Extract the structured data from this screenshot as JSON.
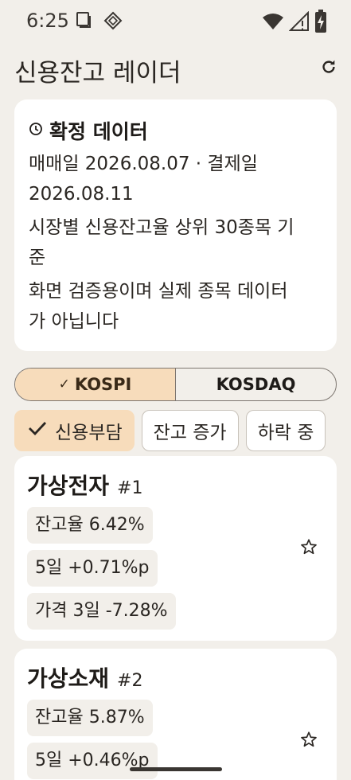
{
  "status_bar": {
    "time": "6:25",
    "icons": [
      "screenshot-icon",
      "app-notification-icon",
      "wifi-icon",
      "cell-signal-icon",
      "battery-charging-icon"
    ]
  },
  "app_bar": {
    "title": "신용잔고 레이더",
    "action_icon": "refresh-icon"
  },
  "info_card": {
    "icon": "clock-icon",
    "title": "확정 데이터",
    "dates_line1": "매매일 2026.08.07 · 결제일",
    "dates_line2": "2026.08.11",
    "criteria_line1": "시장별 신용잔고율 상위 30종목 기",
    "criteria_line2": "준",
    "disclaimer_line1": "화면 검증용이며 실제 종목 데이터",
    "disclaimer_line2": "가 아닙니다"
  },
  "market_tabs": [
    {
      "label": "KOSPI",
      "selected": true
    },
    {
      "label": "KOSDAQ",
      "selected": false
    }
  ],
  "filters": [
    {
      "label": "신용부담",
      "selected": true
    },
    {
      "label": "잔고 증가",
      "selected": false
    },
    {
      "label": "하락 중",
      "selected": false
    }
  ],
  "stocks": [
    {
      "name": "가상전자",
      "rank": "#1",
      "balance_rate": "잔고율 6.42%",
      "change_5d": "5일 +0.71%p",
      "price_3d": "가격 3일 -7.28%",
      "favorite_icon": "star-outline-icon"
    },
    {
      "name": "가상소재",
      "rank": "#2",
      "balance_rate": "잔고율 5.87%",
      "change_5d": "5일 +0.46%p",
      "favorite_icon": "star-outline-icon"
    }
  ],
  "colors": {
    "background": "#f2efea",
    "card": "#ffffff",
    "accent": "#f7dcbb",
    "text": "#1e1b18"
  }
}
